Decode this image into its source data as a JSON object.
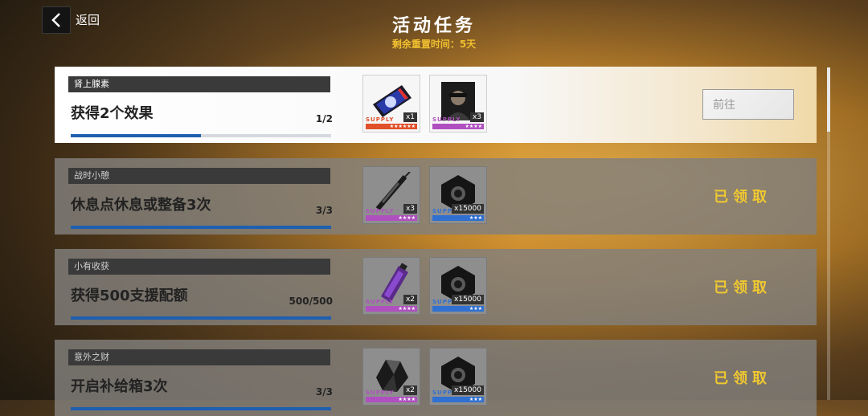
{
  "nav": {
    "back_label": "返回"
  },
  "header": {
    "title": "活动任务",
    "subtitle": "剩余重置时间：5天"
  },
  "colors": {
    "accent_blue": "#1e5fb0",
    "claimed_yellow": "#f0c830",
    "subtitle_yellow": "#f0c030"
  },
  "tasks": [
    {
      "tag": "肾上腺素",
      "name": "获得2个效果",
      "progress_text": "1/2",
      "progress": 0.5,
      "state": "active",
      "action_label": "前往",
      "rewards": [
        {
          "icon": "ticket-card-icon",
          "supply": "SUPPLY",
          "qty": "x1",
          "stars": "★★★★★★",
          "rarity_color": "#e0502a"
        },
        {
          "icon": "character-card-icon",
          "supply": "SUPPLY",
          "qty": "x3",
          "stars": "★★★★",
          "rarity_color": "#b050c0"
        }
      ]
    },
    {
      "tag": "战时小憩",
      "name": "休息点休息或整备3次",
      "progress_text": "3/3",
      "progress": 1,
      "state": "done",
      "action_label": "已领取",
      "rewards": [
        {
          "icon": "syringe-icon",
          "supply": "SUPPLY",
          "qty": "x3",
          "stars": "★★★★",
          "rarity_color": "#b050c0"
        },
        {
          "icon": "hex-nut-icon",
          "supply": "SUPPLY",
          "qty": "x15000",
          "stars": "★★★",
          "rarity_color": "#3070d0"
        }
      ]
    },
    {
      "tag": "小有收获",
      "name": "获得500支援配额",
      "progress_text": "500/500",
      "progress": 1,
      "state": "done",
      "action_label": "已领取",
      "rewards": [
        {
          "icon": "battery-pack-icon",
          "supply": "SUPPLY",
          "qty": "x2",
          "stars": "★★★★",
          "rarity_color": "#b050c0"
        },
        {
          "icon": "hex-nut-icon",
          "supply": "SUPPLY",
          "qty": "x15000",
          "stars": "★★★",
          "rarity_color": "#3070d0"
        }
      ]
    },
    {
      "tag": "意外之财",
      "name": "开启补给箱3次",
      "progress_text": "3/3",
      "progress": 1,
      "state": "done",
      "action_label": "已领取",
      "rewards": [
        {
          "icon": "crystal-ore-icon",
          "supply": "SUPPLY",
          "qty": "x2",
          "stars": "★★★★",
          "rarity_color": "#b050c0"
        },
        {
          "icon": "hex-nut-icon",
          "supply": "SUPPLY",
          "qty": "x15000",
          "stars": "★★★",
          "rarity_color": "#3070d0"
        }
      ]
    }
  ]
}
